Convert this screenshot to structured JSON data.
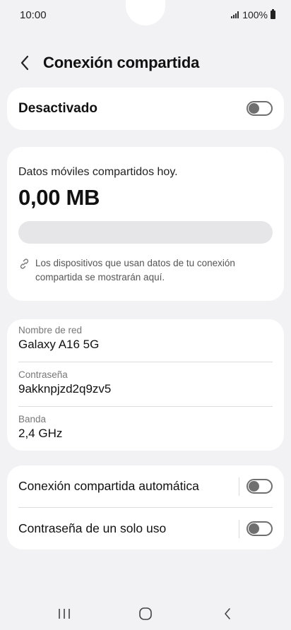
{
  "status_bar": {
    "time": "10:00",
    "battery_text": "100%"
  },
  "header": {
    "title": "Conexión compartida",
    "back_icon": "chevron-left-icon"
  },
  "master_toggle": {
    "label": "Desactivado",
    "state": "off"
  },
  "usage": {
    "caption": "Datos móviles compartidos hoy.",
    "value": "0,00 MB",
    "bar_fill_fraction": 0,
    "info_icon": "link-icon",
    "info_text": "Los dispositivos que usan datos de tu conexión compartida se mostrarán aquí."
  },
  "network": {
    "rows": [
      {
        "label": "Nombre de red",
        "value": "Galaxy A16 5G"
      },
      {
        "label": "Contraseña",
        "value": "9akknpjzd2q9zv5"
      },
      {
        "label": "Banda",
        "value": "2,4 GHz"
      }
    ]
  },
  "options": {
    "items": [
      {
        "label": "Conexión compartida automática",
        "state": "off"
      },
      {
        "label": "Contraseña de un solo uso",
        "state": "off"
      }
    ]
  },
  "navbar": {
    "icons": [
      "recent-apps-icon",
      "home-icon",
      "back-icon"
    ]
  },
  "colors": {
    "background": "#f2f2f4",
    "card": "#ffffff",
    "switch_off": "#6f6f6f",
    "progress_track": "#e6e6e8"
  }
}
